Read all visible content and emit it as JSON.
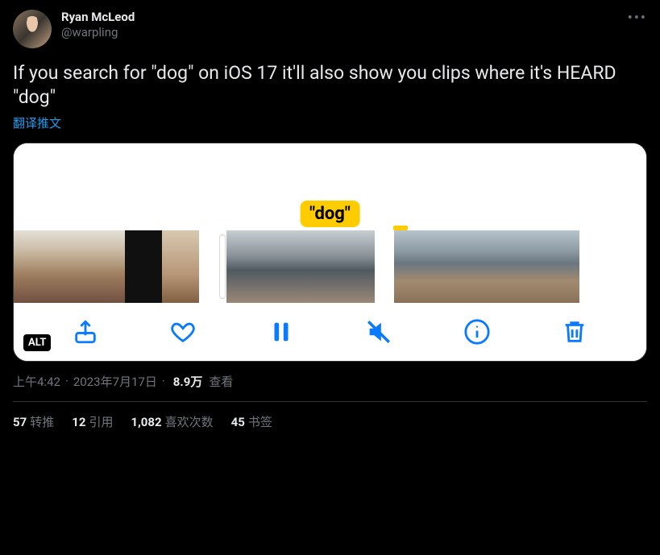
{
  "author": {
    "display_name": "Ryan McLeod",
    "handle": "@warpling"
  },
  "tweet_text": "If you search for \"dog\" on iOS 17 it'll also show you clips where it's HEARD \"dog\"",
  "translate_label": "翻译推文",
  "media": {
    "search_label": "\"dog\"",
    "alt_badge": "ALT"
  },
  "meta": {
    "time": "上午4:42",
    "date": "2023年7月17日",
    "views_number": "8.9万",
    "views_label": "查看"
  },
  "stats": {
    "retweets_num": "57",
    "retweets_label": "转推",
    "quotes_num": "12",
    "quotes_label": "引用",
    "likes_num": "1,082",
    "likes_label": "喜欢次数",
    "bookmarks_num": "45",
    "bookmarks_label": "书签"
  }
}
